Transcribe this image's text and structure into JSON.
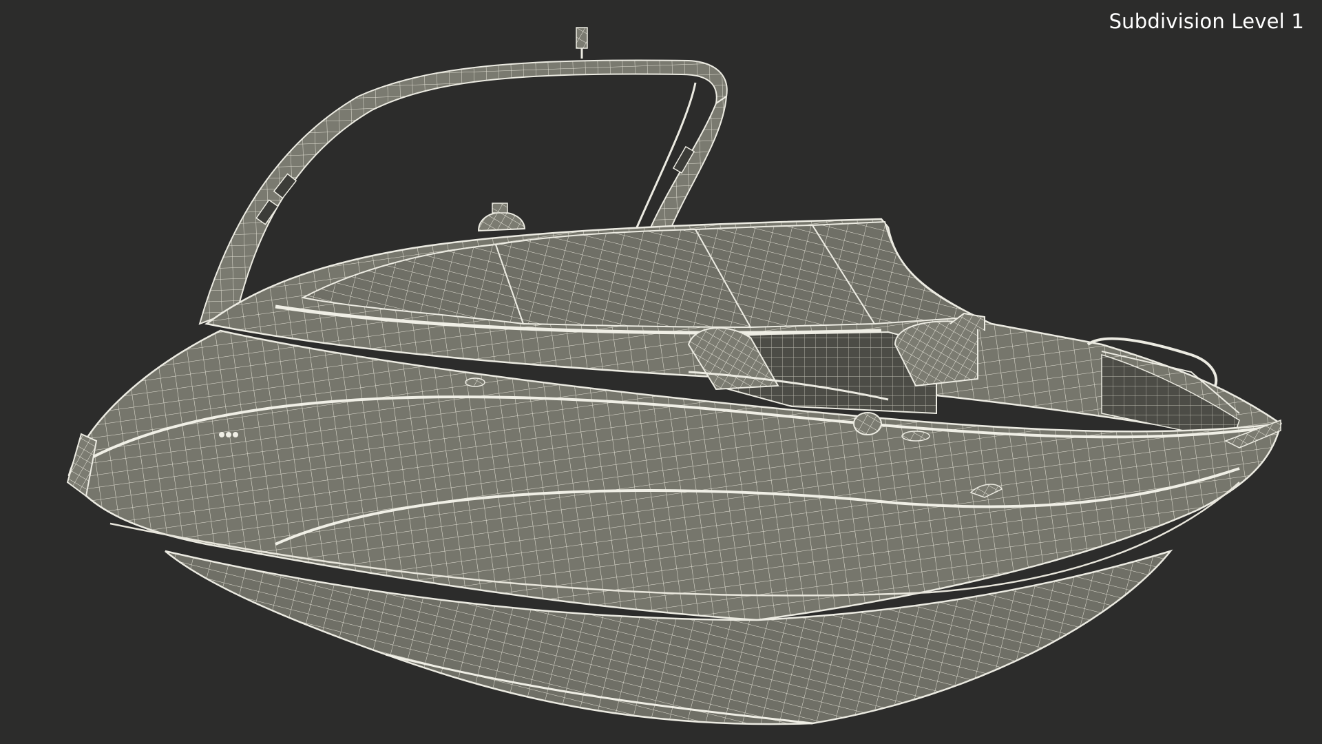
{
  "viewport": {
    "label": "Subdivision Level 1",
    "background_color": "#2c2c2b"
  },
  "model": {
    "subject": "speedboat-wireframe",
    "wire_color": "#e8e6dc",
    "surface_color": "#77776d"
  }
}
